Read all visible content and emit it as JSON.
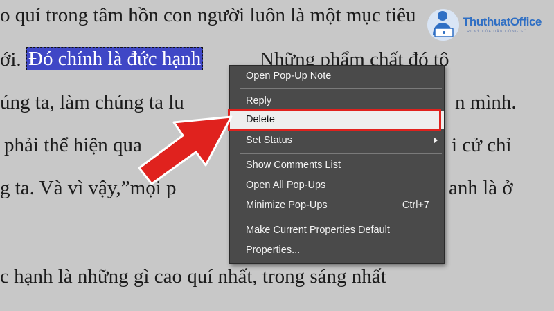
{
  "document": {
    "lines": [
      "o quí trong tâm hồn con người luôn là một mục tiêu",
      "ới. ",
      "úng ta, làm chúng ta lu",
      "phải thể hiện qua",
      "g ta. Và vì vậy,”mọi p",
      "c hạnh là những gì cao quí nhất, trong sáng nhất"
    ],
    "line2_tail": " Những phẩm chất đó tô",
    "highlighted": "Đó chính là đức hạnh",
    "right_fragments": {
      "line3": "n mình.",
      "line4": "i cử chỉ",
      "line5": "anh là ở"
    }
  },
  "logo": {
    "name": "ThuthuatOffice",
    "tagline": "TRI KỲ CỦA DÂN CÔNG SỞ"
  },
  "context_menu": {
    "items": [
      {
        "label": "Open Pop-Up Note",
        "shortcut": ""
      },
      {
        "label": "Reply",
        "shortcut": ""
      },
      {
        "label": "Delete",
        "shortcut": ""
      },
      {
        "label": "Set Status",
        "shortcut": ""
      },
      {
        "label": "Show Comments List",
        "shortcut": ""
      },
      {
        "label": "Open All Pop-Ups",
        "shortcut": ""
      },
      {
        "label": "Minimize Pop-Ups",
        "shortcut": "Ctrl+7"
      },
      {
        "label": "Make Current Properties Default",
        "shortcut": ""
      },
      {
        "label": "Properties...",
        "shortcut": ""
      }
    ],
    "selected": "Delete",
    "submenu_item": "Set Status"
  },
  "colors": {
    "highlight": "#3f47c6",
    "menu_bg": "#4a4a4a",
    "callout": "#e0221e",
    "logo": "#2f6fc4"
  },
  "icons": {
    "annotation_arrow": "red-arrow-icon",
    "submenu": "chevron-right-icon",
    "logo_mark": "person-laptop-icon"
  }
}
